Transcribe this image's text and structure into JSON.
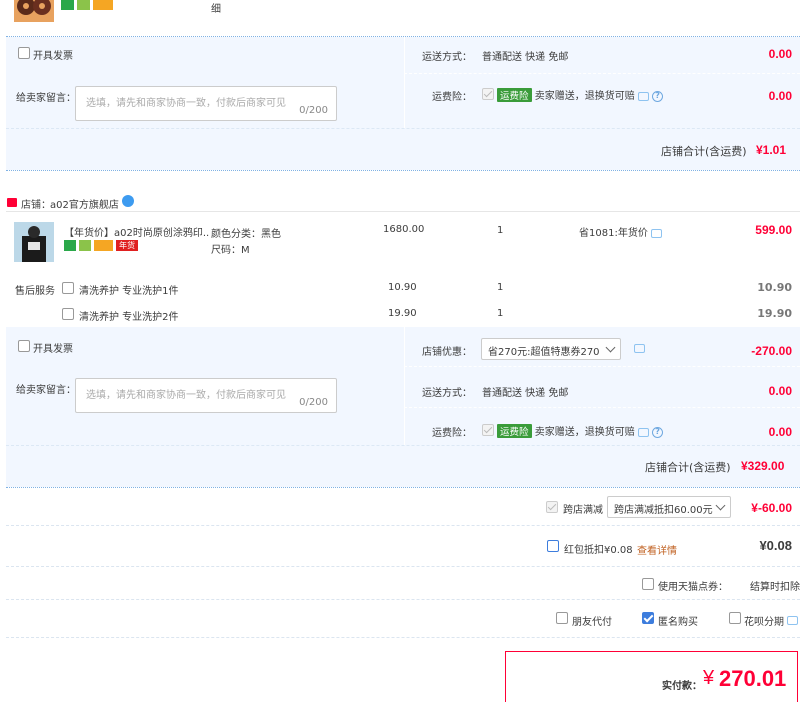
{
  "store1": {
    "item_spec_tail": "细",
    "invoice_label": "开具发票",
    "shipping_label": "运送方式：",
    "shipping_value": "普通配送 快递 免邮",
    "shipping_price": "0.00",
    "message_label": "给卖家留言：",
    "message_placeholder": "选填，请先和商家协商一致，付款后商家可见",
    "message_count": "0/200",
    "insurance_label": "运费险：",
    "insurance_tag": "运费险",
    "insurance_text": "卖家赠送，退换货可赔",
    "insurance_price": "0.00",
    "total_label": "店铺合计(含运费)",
    "total_value": "¥1.01"
  },
  "store2": {
    "store_badge": "天猫",
    "store_label": "店铺：",
    "store_name": "a02官方旗舰店",
    "item": {
      "title": "【年货价】a02时尚原创涂鸦印...",
      "badge_nian": "年货",
      "color_label": "颜色分类：黑色",
      "size_label": "尺码：M",
      "unit_price": "1680.00",
      "qty": "1",
      "promo": "省1081:年货价",
      "subtotal": "599.00"
    },
    "after_sale_label": "售后服务",
    "services": [
      {
        "name": "清洗养护 专业洗护1件",
        "price": "10.90",
        "qty": "1",
        "subtotal": "10.90"
      },
      {
        "name": "清洗养护 专业洗护2件",
        "price": "19.90",
        "qty": "1",
        "subtotal": "19.90"
      }
    ],
    "invoice_label": "开具发票",
    "coupon_label": "店铺优惠：",
    "coupon_value": "省270元:超值特惠券270",
    "coupon_price": "-270.00",
    "shipping_label": "运送方式：",
    "shipping_value": "普通配送 快递 免邮",
    "shipping_price": "0.00",
    "message_label": "给卖家留言：",
    "message_placeholder": "选填，请先和商家协商一致，付款后商家可见",
    "message_count": "0/200",
    "insurance_label": "运费险：",
    "insurance_tag": "运费险",
    "insurance_text": "卖家赠送，退换货可赔",
    "insurance_price": "0.00",
    "total_label": "店铺合计(含运费)",
    "total_value": "¥329.00"
  },
  "summary": {
    "cross_label": "跨店满减",
    "cross_select": "跨店满减抵扣60.00元",
    "cross_value": "¥-60.00",
    "redpacket_label": "红包抵扣¥0.08",
    "redpacket_link": "查看详情",
    "redpacket_value": "¥0.08",
    "points_label": "使用天猫点券：",
    "points_value": "结算时扣除",
    "friend_pay": "朋友代付",
    "anonymous": "匿名购买",
    "huabei": "花呗分期",
    "pay_label": "实付款：",
    "pay_currency": "¥",
    "pay_value": "270.01"
  },
  "colors": {
    "accent_red": "#ff0036",
    "band_blue": "#f2f7ff",
    "check_blue": "#3d7ddd",
    "insurance_green": "#3a9c3a"
  }
}
